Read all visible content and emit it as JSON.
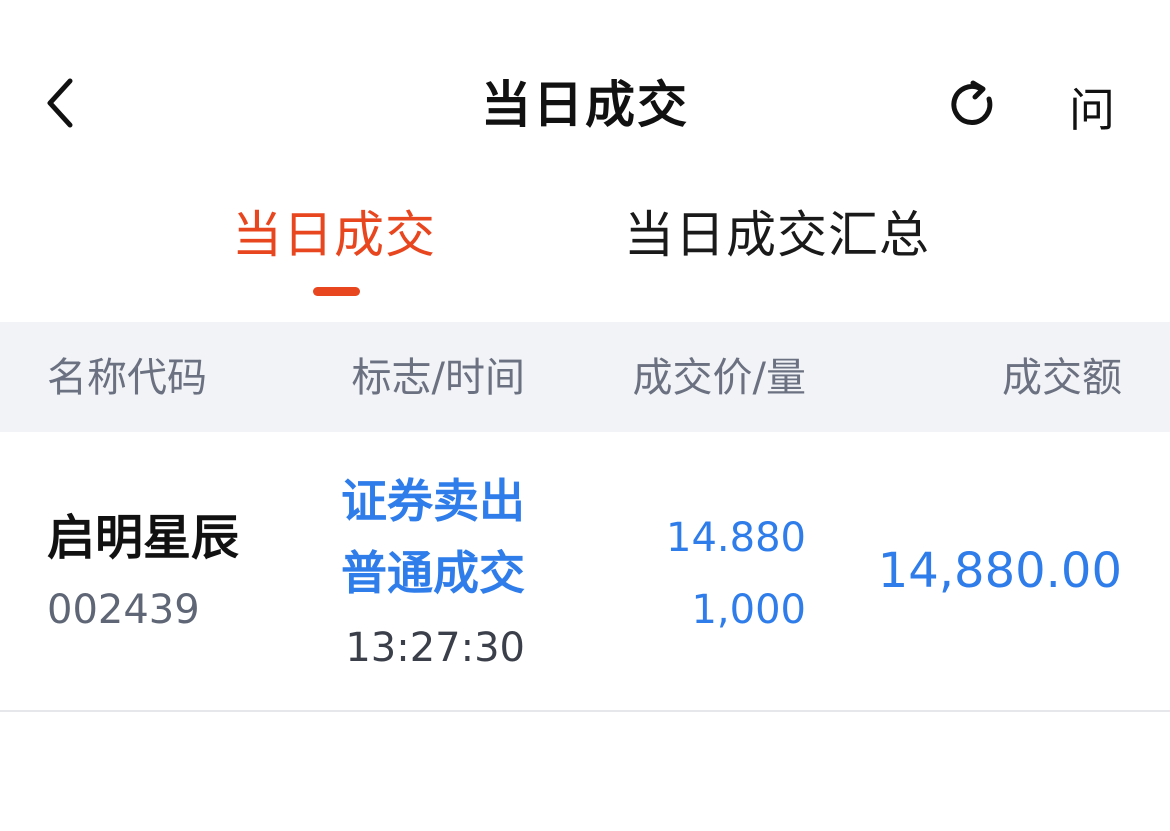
{
  "nav": {
    "title": "当日成交",
    "back_icon": "chevron-left-icon",
    "refresh_icon": "refresh-icon",
    "ask_label": "问"
  },
  "tabs": [
    {
      "label": "当日成交",
      "active": true
    },
    {
      "label": "当日成交汇总",
      "active": false
    }
  ],
  "table": {
    "columns": [
      "名称代码",
      "标志/时间",
      "成交价/量",
      "成交额"
    ],
    "rows": [
      {
        "name": "启明星辰",
        "code": "002439",
        "flag_line1": "证券卖出",
        "flag_line2": "普通成交",
        "time": "13:27:30",
        "price": "14.880",
        "quantity": "1,000",
        "amount": "14,880.00"
      }
    ]
  },
  "colors": {
    "accent": "#e8461e",
    "value_blue": "#2f7dea",
    "header_bg": "#f1f3f7",
    "muted_text": "#6b7180"
  }
}
